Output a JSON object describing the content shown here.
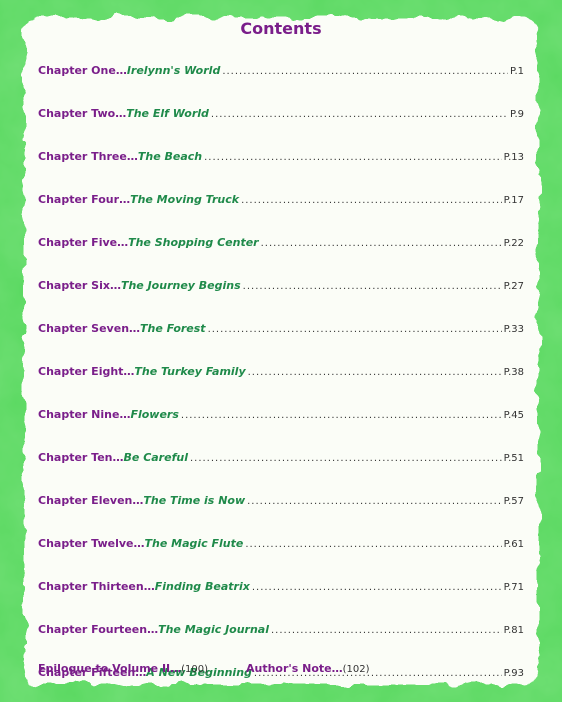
{
  "title": "Contents",
  "colors": {
    "border_green": "#3fd04a",
    "chapter_purple": "#7a1e8a",
    "title_green": "#1f8a4a",
    "paper": "#fbfdf7"
  },
  "chapters": [
    {
      "chapter": "Chapter One",
      "sep": "…",
      "title": "Irelynn's World",
      "page": "P.1"
    },
    {
      "chapter": "Chapter Two",
      "sep": "…",
      "title": "The Elf World",
      "page": "P.9"
    },
    {
      "chapter": "Chapter Three",
      "sep": "…",
      "title": "The Beach",
      "page": "P.13"
    },
    {
      "chapter": "Chapter Four",
      "sep": "…",
      "title": "The Moving Truck",
      "page": "P.17"
    },
    {
      "chapter": "Chapter Five",
      "sep": "…",
      "title": "The Shopping Center",
      "page": "P.22"
    },
    {
      "chapter": "Chapter Six",
      "sep": "…",
      "title": "The Journey Begins",
      "page": "P.27"
    },
    {
      "chapter": "Chapter Seven",
      "sep": "…",
      "title": "The Forest",
      "page": "P.33"
    },
    {
      "chapter": "Chapter Eight",
      "sep": "…",
      "title": "The Turkey Family",
      "page": "P.38"
    },
    {
      "chapter": "Chapter Nine",
      "sep": "…",
      "title": "Flowers",
      "page": "P.45"
    },
    {
      "chapter": "Chapter Ten",
      "sep": "…",
      "title": "Be Careful",
      "page": "P.51"
    },
    {
      "chapter": "Chapter Eleven",
      "sep": "…",
      "title": "The Time is Now",
      "page": "P.57"
    },
    {
      "chapter": "Chapter Twelve",
      "sep": "…",
      "title": "The Magic Flute",
      "page": "P.61"
    },
    {
      "chapter": "Chapter Thirteen",
      "sep": "…",
      "title": "Finding Beatrix",
      "page": "P.71"
    },
    {
      "chapter": "Chapter Fourteen",
      "sep": "…",
      "title": "The Magic Journal",
      "page": "P.81"
    },
    {
      "chapter": "Chapter Fifteen",
      "sep": "…",
      "title": "A New Beginning",
      "page": "P.93"
    }
  ],
  "footer": {
    "epilogue_label": "Epilogue to Volume II…",
    "epilogue_page": "(100)",
    "note_label": "Author's Note…",
    "note_page": "(102)"
  }
}
